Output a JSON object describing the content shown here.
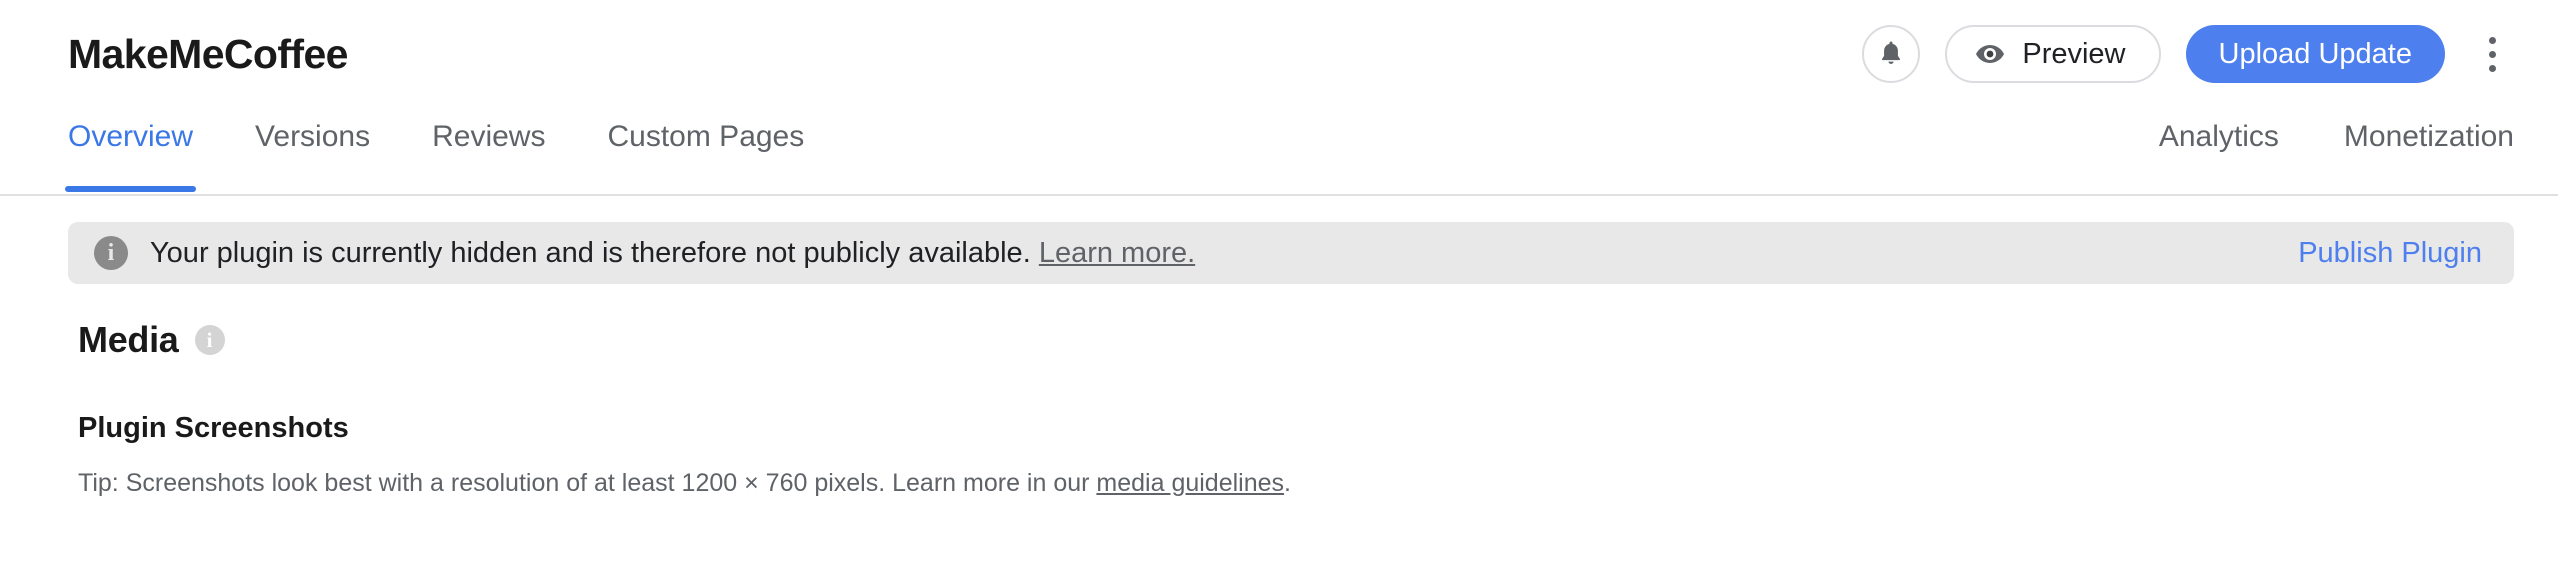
{
  "header": {
    "title": "MakeMeCoffee",
    "notifications_icon": "bell-icon",
    "preview_label": "Preview",
    "preview_icon": "eye-icon",
    "primary_action_label": "Upload Update",
    "overflow_icon": "kebab-menu-icon"
  },
  "tabs": {
    "left": [
      {
        "label": "Overview",
        "active": true
      },
      {
        "label": "Versions",
        "active": false
      },
      {
        "label": "Reviews",
        "active": false
      },
      {
        "label": "Custom Pages",
        "active": false
      }
    ],
    "right": [
      {
        "label": "Analytics",
        "active": false
      },
      {
        "label": "Monetization",
        "active": false
      }
    ]
  },
  "banner": {
    "icon": "info-icon",
    "icon_glyph": "i",
    "message": "Your plugin is currently hidden and is therefore not publicly available.",
    "link_label": "Learn more.",
    "action_label": "Publish Plugin"
  },
  "media": {
    "title": "Media",
    "title_icon": "info-icon",
    "title_icon_glyph": "i",
    "screenshots": {
      "heading": "Plugin Screenshots",
      "tip_prefix": "Tip: Screenshots look best with a resolution of at least 1200 × 760 pixels. Learn more in our ",
      "tip_link": "media guidelines",
      "tip_suffix": "."
    }
  },
  "colors": {
    "accent_blue": "#4d7fee",
    "tab_active_blue": "#3b78e7",
    "banner_bg": "#e8e8e8",
    "muted_text": "#5f6368"
  }
}
